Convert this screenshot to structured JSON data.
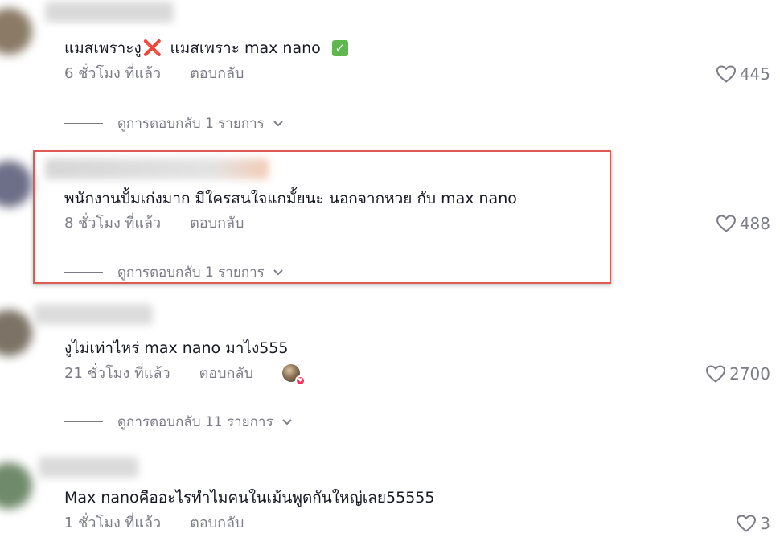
{
  "comments": [
    {
      "text_before": "แมสเพราะงู",
      "x_emoji": "❌",
      "text_after": " แมสเพราะ max nano ",
      "check_emoji": "✅",
      "time": "6 ชั่วโมง ที่แล้ว",
      "reply_label": "ตอบกลับ",
      "likes": "445",
      "view_replies": "ดูการตอบกลับ 1 รายการ"
    },
    {
      "text": "พนักงานปั้มเก่งมาก มีใครสนใจแกมั้ยนะ นอกจากหวย กับ max nano",
      "time": "8 ชั่วโมง ที่แล้ว",
      "reply_label": "ตอบกลับ",
      "likes": "488",
      "view_replies": "ดูการตอบกลับ 1 รายการ"
    },
    {
      "text": "งูไม่เท่าไหร่ max nano มาไง555",
      "time": "21 ชั่วโมง ที่แล้ว",
      "reply_label": "ตอบกลับ",
      "likes": "2700",
      "view_replies": "ดูการตอบกลับ 11 รายการ",
      "creator_liked": true
    },
    {
      "text": "Max nanoคืออะไรทำไมคนในเม้นพูดกันใหญ่เลย55555",
      "time": "1 ชั่วโมง ที่แล้ว",
      "reply_label": "ตอบกลับ",
      "likes": "3"
    }
  ],
  "colors": {
    "text": "#161823",
    "secondary": "#7b7c85",
    "highlight_border": "#e05a55",
    "creator_badge": "#fe2c55"
  },
  "icons": {
    "like": "heart-outline-icon",
    "expand": "chevron-down-icon",
    "creator_badge": "heart-badge-icon"
  }
}
